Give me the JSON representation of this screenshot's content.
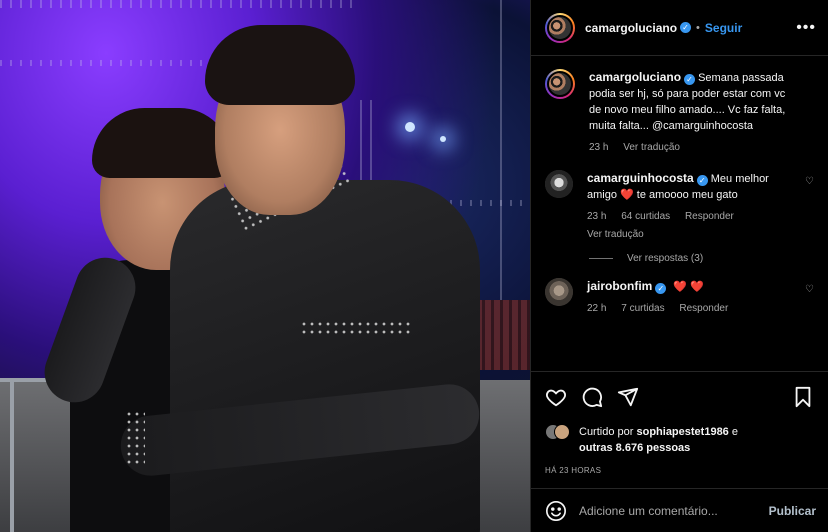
{
  "post": {
    "author": "camargoluciano",
    "follow_label": "Seguir",
    "more_label": "•••",
    "separator": "•"
  },
  "caption": {
    "username": "camargoluciano",
    "text": "Semana passada podia ser hj, só para poder estar com vc de novo meu filho amado.... Vc faz falta, muita falta... @camarguinhocosta",
    "time": "23 h",
    "translate": "Ver tradução"
  },
  "comments": [
    {
      "username": "camarguinhocosta",
      "text_before": "Meu melhor amigo ",
      "text_after": " te amoooo meu gato",
      "emoji": "❤️",
      "time": "23 h",
      "likes": "64 curtidas",
      "reply": "Responder",
      "translate": "Ver tradução",
      "view_replies": "Ver respostas (3)"
    },
    {
      "username": "jairobonfim",
      "emoji": "❤️ ❤️",
      "time": "22 h",
      "likes": "7 curtidas",
      "reply": "Responder"
    }
  ],
  "likes": {
    "prefix": "Curtido por",
    "user": "sophiapestet1986",
    "connector": "e",
    "others": "outras 8.676 pessoas"
  },
  "timestamp": "HÁ 23 HORAS",
  "add_comment": {
    "placeholder": "Adicione um comentário...",
    "publish": "Publicar"
  },
  "colors": {
    "accent": "#3897f0",
    "background": "#000000",
    "muted": "#a8a8a8",
    "heart": "#ed4956"
  },
  "icons": [
    "heart-icon",
    "comment-icon",
    "share-icon",
    "bookmark-icon",
    "emoji-icon",
    "verified-icon"
  ]
}
